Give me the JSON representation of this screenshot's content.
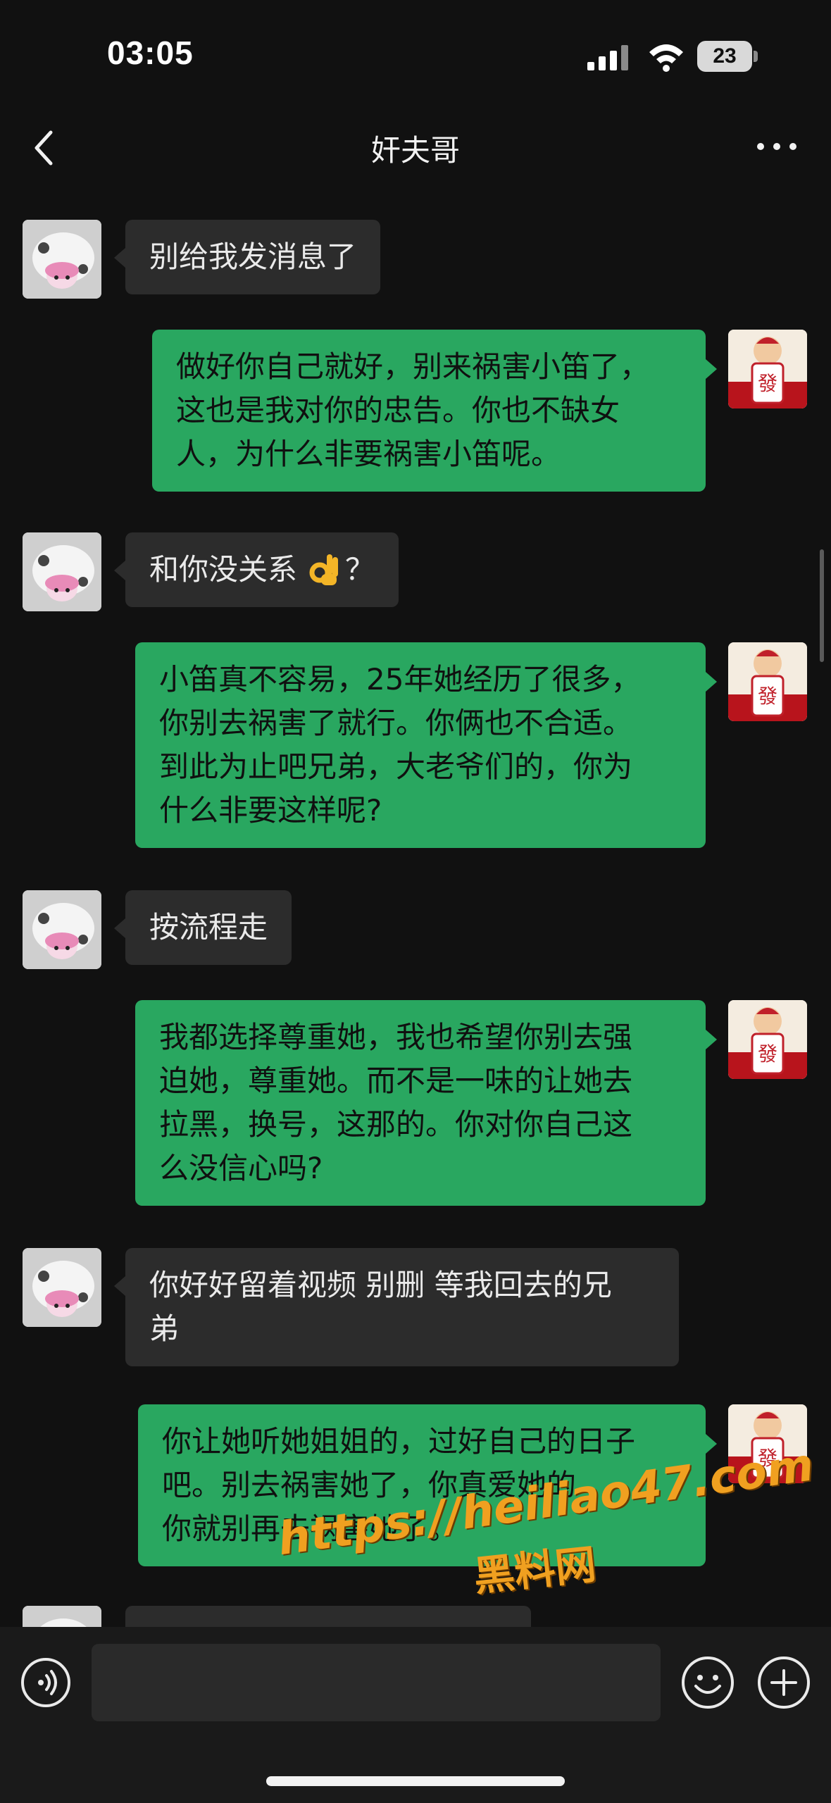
{
  "status_bar": {
    "time": "03:05",
    "battery": "23",
    "signal_icon": "cellular-signal-icon",
    "wifi_icon": "wifi-icon"
  },
  "nav": {
    "back_icon": "chevron-left-icon",
    "title": "奸夫哥",
    "more_icon": "more-dots-icon"
  },
  "colors": {
    "background": "#111111",
    "incoming_bubble": "#2c2c2c",
    "outgoing_bubble": "#29a760",
    "watermark": "#f0a020"
  },
  "messages": [
    {
      "side": "incoming",
      "avatar": "cartoon-cow-avatar",
      "text": "别给我发消息了"
    },
    {
      "side": "outgoing",
      "avatar": "fa-mahjong-avatar",
      "lines": [
        "做好你自己就好，别来祸害小笛了，",
        "这也是我对你的忠告。你也不缺女",
        "人，为什么非要祸害小笛呢。"
      ]
    },
    {
      "side": "incoming",
      "avatar": "cartoon-cow-avatar",
      "text_before": "和你没关系",
      "emoji": "ok-hand-emoji",
      "text_after": "？"
    },
    {
      "side": "outgoing",
      "avatar": "fa-mahjong-avatar",
      "lines": [
        "小笛真不容易，25年她经历了很多，",
        "你别去祸害了就行。你俩也不合适。",
        "到此为止吧兄弟，大老爷们的，你为",
        "什么非要这样呢?"
      ]
    },
    {
      "side": "incoming",
      "avatar": "cartoon-cow-avatar",
      "text": "按流程走"
    },
    {
      "side": "outgoing",
      "avatar": "fa-mahjong-avatar",
      "lines": [
        "我都选择尊重她，我也希望你别去强",
        "迫她，尊重她。而不是一味的让她去",
        "拉黑，换号，这那的。你对你自己这",
        "么没信心吗?"
      ]
    },
    {
      "side": "incoming",
      "avatar": "cartoon-cow-avatar",
      "lines": [
        "你好好留着视频 别删 等我回去的兄",
        "弟"
      ]
    },
    {
      "side": "outgoing",
      "avatar": "fa-mahjong-avatar",
      "lines": [
        "你让她听她姐姐的，过好自己的日子",
        "吧。别去祸害她了，你真爱她的",
        "你就别再去祸害她了。"
      ]
    }
  ],
  "watermark": {
    "url": "https://heiliao47.com",
    "name": "黑料网"
  },
  "input_bar": {
    "voice_icon": "voice-input-icon",
    "input_value": "",
    "emoji_icon": "smiley-icon",
    "add_icon": "plus-circle-icon"
  }
}
